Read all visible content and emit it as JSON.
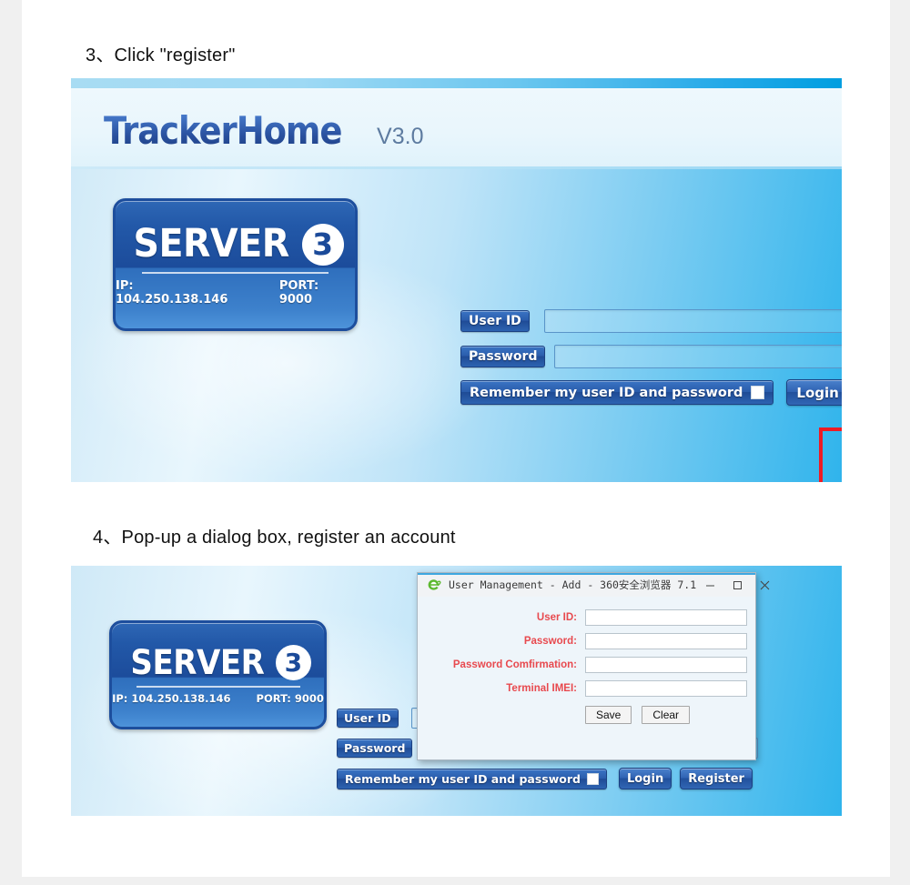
{
  "steps": [
    {
      "number": "3、",
      "text": "Click \"register\""
    },
    {
      "number": "4、",
      "text": "Pop-up a dialog box, register an account"
    }
  ],
  "app": {
    "brand_name": "TrackerHome",
    "brand_version": "V3.0",
    "server_logo": {
      "word": "SERVER",
      "number": "3",
      "ip_label": "IP: 104.250.138.146",
      "port_label": "PORT: 9000"
    },
    "login": {
      "user_id_label": "User ID",
      "password_label": "Password",
      "remember_label": "Remember my user ID and password",
      "login_button": "Login",
      "register_button": "Register",
      "user_id_value": "",
      "password_value": ""
    }
  },
  "dialog": {
    "title": "User Management - Add - 360安全浏览器 7.1",
    "icon": "green-e-browser-icon",
    "window_controls": {
      "minimize": "minimize-icon",
      "maximize": "maximize-icon",
      "close": "close-icon"
    },
    "fields": [
      {
        "label": "User ID:",
        "value": ""
      },
      {
        "label": "Password:",
        "value": ""
      },
      {
        "label": "Password Comfirmation:",
        "value": ""
      },
      {
        "label": "Terminal IMEI:",
        "value": ""
      }
    ],
    "buttons": {
      "save": "Save",
      "clear": "Clear"
    }
  },
  "annotation": {
    "highlight_color": "#ee1b24",
    "highlight_target": "register-button"
  },
  "colors": {
    "brand_blue": "#2a52a0",
    "panel_accent": "#009ee0",
    "label_red": "#e8494e",
    "button_blue": "#21509c"
  }
}
